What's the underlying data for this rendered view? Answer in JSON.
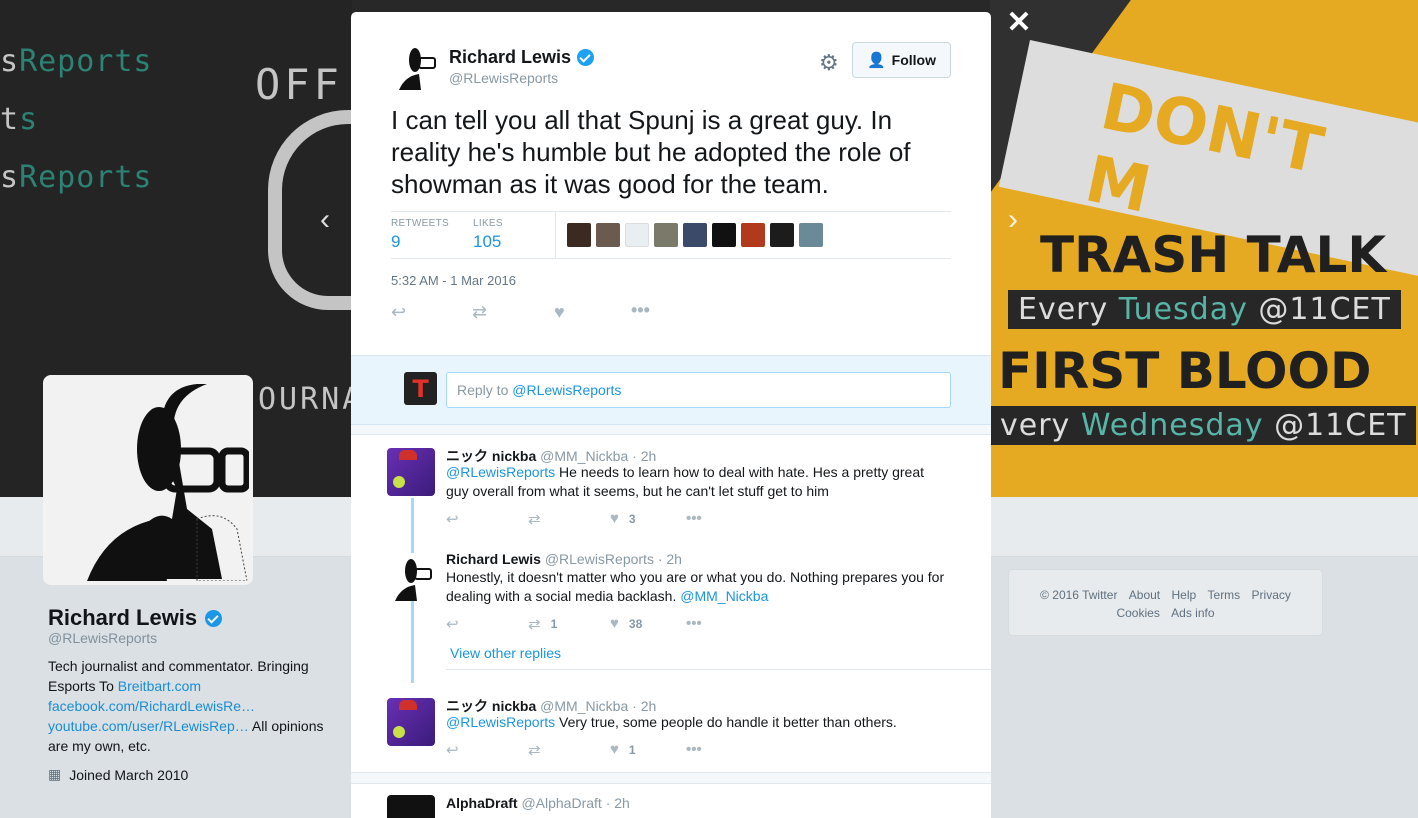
{
  "banner": {
    "report_lines": [
      {
        "prefix": "s",
        "text": "Reports"
      },
      {
        "prefix": "t",
        "text": "s"
      },
      {
        "prefix": "s",
        "text": "Reports"
      }
    ],
    "off_text": "OFF",
    "journal_text": "OURNA",
    "dont_text": "DON'T M",
    "trash_talk": "TRASH TALK",
    "tuesday": {
      "every": "Every ",
      "day": "Tuesday",
      "time": " @11CET"
    },
    "first_blood": "FIRST BLOOD",
    "wednesday": {
      "every": "very ",
      "day": "Wednesday",
      "time": " @11CET"
    }
  },
  "profile": {
    "name": "Richard Lewis",
    "handle": "@RLewisReports",
    "bio_text_1": "Tech journalist and commentator. Bringing Esports To ",
    "bio_link_1": "Breitbart.com",
    "bio_link_2": "facebook.com/RichardLewisRe…",
    "bio_link_3": "youtube.com/user/RLewisRep…",
    "bio_text_2": " All opinions are my own, etc.",
    "joined": "Joined March 2010"
  },
  "footer": {
    "links": [
      "© 2016 Twitter",
      "About",
      "Help",
      "Terms",
      "Privacy",
      "Cookies",
      "Ads info"
    ]
  },
  "modal": {
    "close": "✕",
    "prev": "‹",
    "next": "›",
    "tweet": {
      "name": "Richard Lewis",
      "handle": "@RLewisReports",
      "follow_label": "Follow",
      "text": "I can tell you all that Spunj is a great guy. In reality he's humble but he adopted the role of showman as it was good for the team.",
      "retweets_label": "RETWEETS",
      "retweets": "9",
      "likes_label": "LIKES",
      "likes": "105",
      "timestamp": "5:32 AM - 1 Mar 2016"
    },
    "reply_box": {
      "prefix": "Reply to ",
      "mention": "@RLewisReports"
    },
    "replies": [
      {
        "name": "ニック nickba",
        "handle": "@MM_Nickba",
        "time": "· 2h",
        "mention": "@RLewisReports",
        "text": " He needs to learn how to deal with hate. Hes a pretty great guy overall from what it seems, but he can't let stuff get to him",
        "retweets": "",
        "likes": "3"
      },
      {
        "name": "Richard Lewis",
        "handle": "@RLewisReports",
        "time": "· 2h",
        "text": "Honestly, it doesn't matter who you are or what you do. Nothing prepares you for dealing with a social media backlash. ",
        "mention_end": "@MM_Nickba",
        "retweets": "1",
        "likes": "38"
      },
      {
        "name": "ニック nickba",
        "handle": "@MM_Nickba",
        "time": "· 2h",
        "mention": "@RLewisReports",
        "text": " Very true, some people do handle it better than others.",
        "retweets": "",
        "likes": "1"
      },
      {
        "name": "AlphaDraft",
        "handle": "@AlphaDraft",
        "time": "· 2h"
      }
    ],
    "view_other_replies": "View other replies"
  },
  "colors": {
    "link": "#1b95e0",
    "verified": "#1da1f2",
    "banner_yellow": "#f3b324",
    "banner_teal": "#5bbfb0"
  }
}
